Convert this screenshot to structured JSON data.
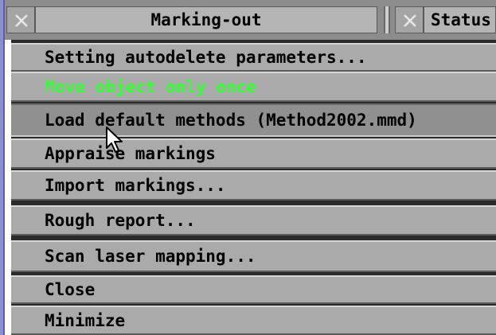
{
  "windows": {
    "marking_out": {
      "title": "Marking-out"
    },
    "status": {
      "title": "Status"
    }
  },
  "menu": {
    "items": [
      {
        "label": "Setting autodelete parameters...",
        "state": "normal"
      },
      {
        "label": "Move object only once",
        "state": "highlight",
        "color": "#33ff33"
      },
      {
        "label": "Load default methods (Method2002.mmd)",
        "state": "hover"
      },
      {
        "label": "Appraise markings",
        "state": "normal"
      },
      {
        "label": "Import markings...",
        "state": "normal"
      },
      {
        "label": "Rough report...",
        "state": "normal"
      },
      {
        "label": "Scan laser mapping...",
        "state": "normal"
      },
      {
        "label": "Close",
        "state": "normal"
      },
      {
        "label": "Minimize",
        "state": "normal"
      }
    ]
  },
  "icons": {
    "close": "close-icon",
    "cursor": "arrow-cursor-icon"
  }
}
